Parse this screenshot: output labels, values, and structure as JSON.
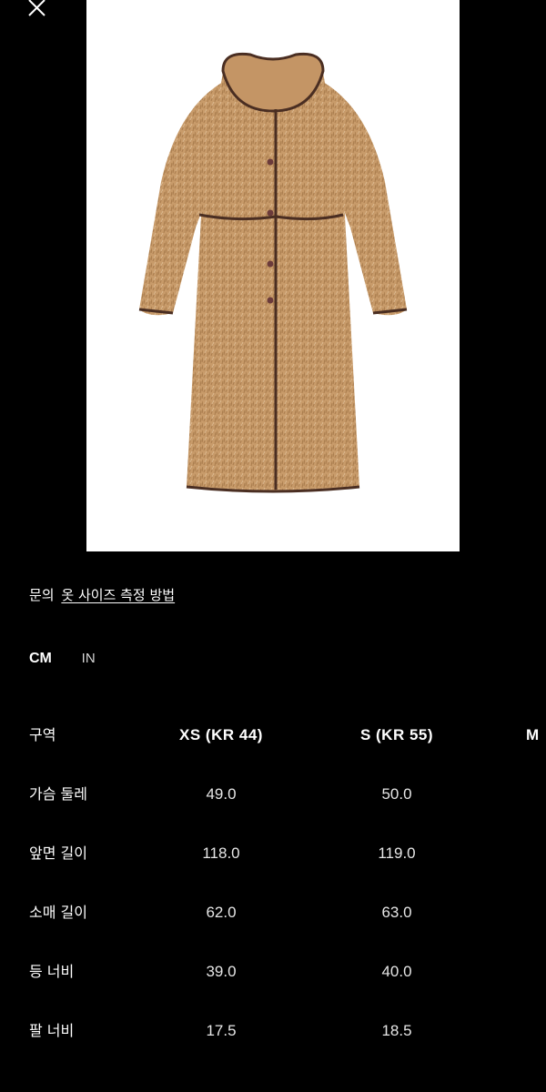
{
  "close_button": {
    "icon": "close-icon",
    "label": ""
  },
  "product_image": {
    "alt": "",
    "icon": "coat-image",
    "background": "#ffffff",
    "coat_color": "#c89b6a",
    "trim_color": "#4a2e22"
  },
  "links": {
    "inquiry": "문의",
    "size_guide": "옷 사이즈 측정 방법"
  },
  "units": {
    "active": "CM",
    "inactive": "IN"
  },
  "size_table": {
    "header": {
      "label": "구역",
      "sizes": [
        "XS (KR 44)",
        "S (KR 55)",
        "M"
      ]
    },
    "rows": [
      {
        "label": "가슴 둘레",
        "values": [
          "49.0",
          "50.0"
        ]
      },
      {
        "label": "앞면 길이",
        "values": [
          "118.0",
          "119.0"
        ]
      },
      {
        "label": "소매 길이",
        "values": [
          "62.0",
          "63.0"
        ]
      },
      {
        "label": "등 너비",
        "values": [
          "39.0",
          "40.0"
        ]
      },
      {
        "label": "팔 너비",
        "values": [
          "17.5",
          "18.5"
        ]
      }
    ]
  }
}
